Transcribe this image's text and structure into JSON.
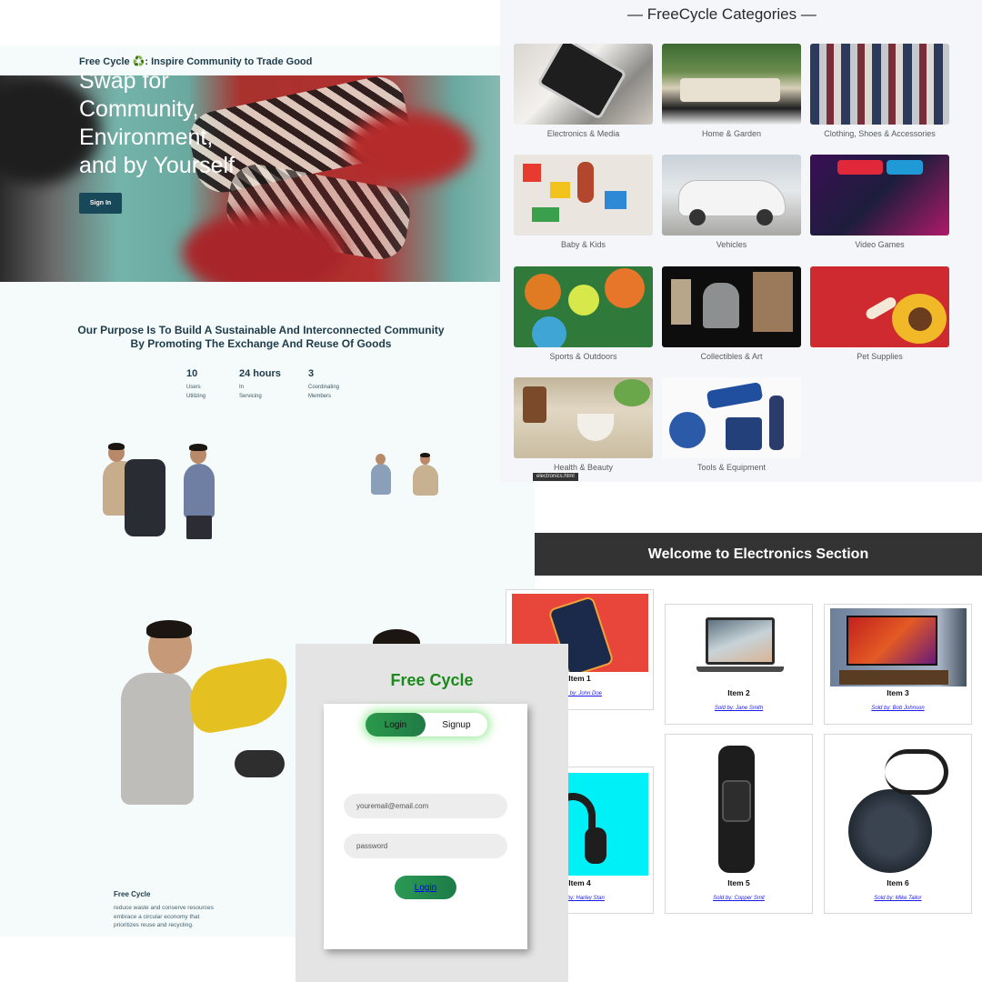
{
  "landing": {
    "site_title": "Free Cycle ♻️: Inspire Community to Trade Good",
    "hero_lines": [
      "Swap for",
      "Community,",
      "Environment,",
      "and by Yourself"
    ],
    "signin_label": "Sign In",
    "purpose": "Our Purpose Is To Build A Sustainable And Interconnected Community By Promoting The Exchange And Reuse Of Goods",
    "stats": [
      {
        "num": "10",
        "lbl1": "Users",
        "lbl2": "Utilizing"
      },
      {
        "num": "24 hours",
        "lbl1": "In",
        "lbl2": "Servicing"
      },
      {
        "num": "3",
        "lbl1": "Coordinating",
        "lbl2": "Members"
      }
    ],
    "footer_brand": "Free Cycle",
    "footer_lines": [
      "reduce waste and conserve resources",
      "embrace a circular economy that",
      "prioritizes reuse and recycling."
    ]
  },
  "categories": {
    "title": "FreeCycle Categories",
    "items": [
      {
        "label": "Electronics & Media"
      },
      {
        "label": "Home & Garden"
      },
      {
        "label": "Clothing, Shoes & Accessories"
      },
      {
        "label": "Baby & Kids"
      },
      {
        "label": "Vehicles"
      },
      {
        "label": "Video Games"
      },
      {
        "label": "Sports & Outdoors"
      },
      {
        "label": "Collectibles & Art"
      },
      {
        "label": "Pet Supplies"
      },
      {
        "label": "Health & Beauty"
      },
      {
        "label": "Tools & Equipment"
      }
    ],
    "url_tooltip": "electronics.html"
  },
  "electronics": {
    "banner": "Welcome to Electronics Section",
    "items": [
      {
        "name": "Item 1",
        "seller": "Sold by: John Doe"
      },
      {
        "name": "Item 2",
        "seller": "Sold by: Jane Smith"
      },
      {
        "name": "Item 3",
        "seller": "Sold by: Bob Johnson"
      },
      {
        "name": "Item 4",
        "seller": "Sold by: Harley Stan"
      },
      {
        "name": "Item 5",
        "seller": "Sold by: Copper Smit"
      },
      {
        "name": "Item 6",
        "seller": "Sold by: Mike Tailor"
      }
    ]
  },
  "login": {
    "brand": "Free Cycle",
    "tab_login": "Login",
    "tab_signup": "Signup",
    "email_placeholder": "youremail@email.com",
    "password_placeholder": "password",
    "submit_label": "Login"
  },
  "colors": {
    "brand_green": "#1b8a1b",
    "navy": "#1e3b49",
    "banner_dark": "#333333"
  }
}
